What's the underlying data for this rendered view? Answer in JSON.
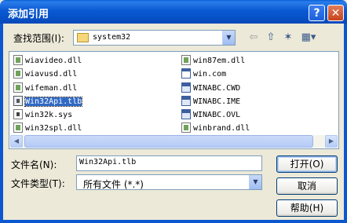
{
  "window": {
    "title": "添加引用",
    "help_glyph": "?",
    "close_glyph": "✕"
  },
  "lookin": {
    "label": "查找范围(I):",
    "value": "system32",
    "arrow": "▼",
    "back_glyph": "⇦",
    "up_glyph": "⇧",
    "newfolder_glyph": "✶",
    "views_glyph": "▦▾"
  },
  "files": [
    {
      "name": "wiavideo.dll",
      "icon": "dll-icon",
      "selected": false
    },
    {
      "name": "wiavusd.dll",
      "icon": "dll-icon",
      "selected": false
    },
    {
      "name": "wifeman.dll",
      "icon": "dll-icon",
      "selected": false
    },
    {
      "name": "Win32Api.tlb",
      "icon": "tlb-icon",
      "selected": true
    },
    {
      "name": "win32k.sys",
      "icon": "sys-icon",
      "selected": false
    },
    {
      "name": "win32spl.dll",
      "icon": "dll-icon",
      "selected": false
    },
    {
      "name": "win87em.dll",
      "icon": "dll-icon",
      "selected": false
    },
    {
      "name": "win.com",
      "icon": "com-icon",
      "selected": false
    },
    {
      "name": "WINABC.CWD",
      "icon": "ime-icon",
      "selected": false
    },
    {
      "name": "WINABC.IME",
      "icon": "ime-icon",
      "selected": false
    },
    {
      "name": "WINABC.OVL",
      "icon": "ime-icon",
      "selected": false
    },
    {
      "name": "winbrand.dll",
      "icon": "dll-icon",
      "selected": false
    }
  ],
  "scrollbar": {
    "left_glyph": "◀",
    "right_glyph": "▶"
  },
  "filename": {
    "label": "文件名(N):",
    "value": "Win32Api.tlb"
  },
  "filetype": {
    "label": "文件类型(T):",
    "value": "所有文件 (*.*)",
    "arrow": "▼"
  },
  "buttons": {
    "open": "打开(O)",
    "cancel": "取消",
    "help": "帮助(H)"
  },
  "colors": {
    "titlebar": "#0a5fd6",
    "selection": "#316ac5",
    "dialog_bg": "#ece9d8"
  }
}
